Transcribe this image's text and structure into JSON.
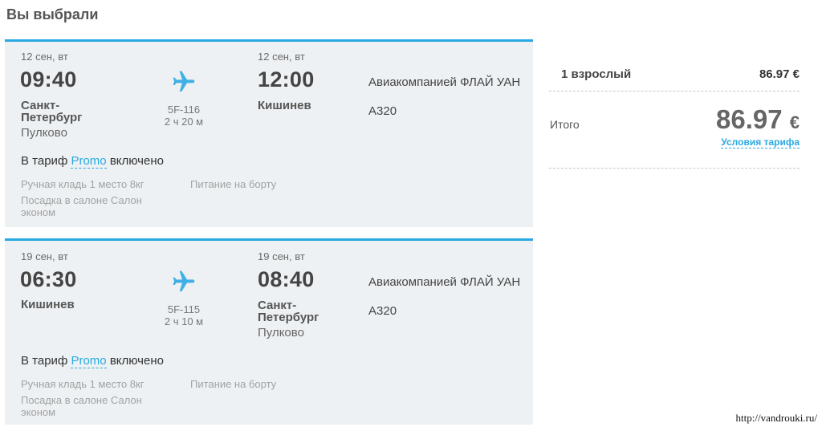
{
  "title": "Вы выбрали",
  "flights": [
    {
      "depart": {
        "date": "12 сен, вт",
        "time": "09:40",
        "city": "Санкт-Петербург",
        "airport": "Пулково"
      },
      "flight_number": "5F-116",
      "duration": "2 ч 20 м",
      "arrive": {
        "date": "12 сен, вт",
        "time": "12:00",
        "city": "Кишинев",
        "airport": ""
      },
      "airline": "Авиакомпанией ФЛАЙ УАН",
      "aircraft": "A320",
      "tariff_prefix": "В тариф",
      "tariff_name": "Promo",
      "tariff_suffix": "включено",
      "baggage": "Ручная кладь 1 место 8кг",
      "meal": "Питание на борту",
      "seating": "Посадка в салоне Салон эконом"
    },
    {
      "depart": {
        "date": "19 сен, вт",
        "time": "06:30",
        "city": "Кишинев",
        "airport": ""
      },
      "flight_number": "5F-115",
      "duration": "2 ч 10 м",
      "arrive": {
        "date": "19 сен, вт",
        "time": "08:40",
        "city": "Санкт-Петербург",
        "airport": "Пулково"
      },
      "airline": "Авиакомпанией ФЛАЙ УАН",
      "aircraft": "A320",
      "tariff_prefix": "В тариф",
      "tariff_name": "Promo",
      "tariff_suffix": "включено",
      "baggage": "Ручная кладь 1 место 8кг",
      "meal": "Питание на борту",
      "seating": "Посадка в салоне Салон эконом"
    }
  ],
  "summary": {
    "passengers_label": "1 взрослый",
    "passengers_price": "86.97 €",
    "total_label": "Итого",
    "total_amount": "86.97",
    "currency": "€",
    "conditions_link": "Условия тарифа"
  },
  "watermark": "http://vandrouki.ru/",
  "icons": {
    "flight": "airplane-icon"
  },
  "colors": {
    "accent": "#29a9e1",
    "card_bg": "#eef1f3"
  }
}
